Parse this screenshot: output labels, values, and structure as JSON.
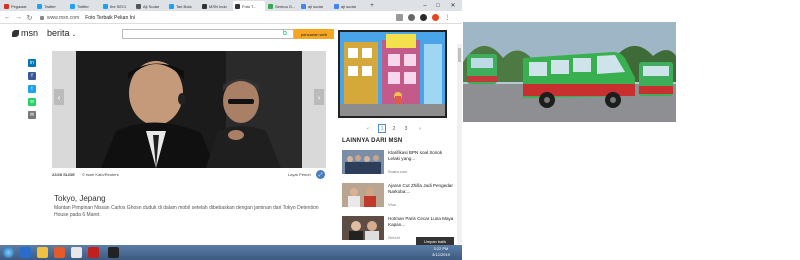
{
  "tabs": [
    {
      "label": "Pegawai",
      "color": "#d93025"
    },
    {
      "label": "Twitter",
      "color": "#1da1f2"
    },
    {
      "label": "Twitter",
      "color": "#1da1f2"
    },
    {
      "label": "the SECI",
      "color": "#1da1f2"
    },
    {
      "label": "Aji Sudar",
      "color": "#555555"
    },
    {
      "label": "Tari Bola",
      "color": "#1da1f2"
    },
    {
      "label": "MSN Indo",
      "color": "#333333"
    },
    {
      "label": "Foto T...",
      "color": "#333333",
      "active": true
    },
    {
      "label": "Semua G...",
      "color": "#34a853"
    },
    {
      "label": "aji sudar",
      "color": "#4285f4"
    },
    {
      "label": "aji sudar",
      "color": "#4285f4"
    }
  ],
  "address": {
    "host": "www.msn.com",
    "title": "Foto Terbaik Pekan Ini"
  },
  "header": {
    "logo": "msn",
    "section": "berita",
    "search_button": "pencarian web"
  },
  "slide": {
    "counter": "22/28 SLIDE",
    "credit": "© Issei Kato/Reuters",
    "fullscreen": "Layar Penuh",
    "title": "Tokyo, Jepang",
    "body": "Mantan Pimpinan Nissan Carlos Ghosn duduk di dalam mobil setelah dibebaskan dengan jaminan dari Tokyo Detention House pada 6 Maret."
  },
  "pager": {
    "pages": [
      "1",
      "2",
      "3"
    ]
  },
  "related": {
    "heading": "LAINNYA DARI MSN",
    "items": [
      {
        "title": "Klarifikasi BPN soal Sosok Lelaki yang...",
        "source": "Suara.com"
      },
      {
        "title": "Ajaran Cut Zhilla Jadi Pengedar Narkoba:...",
        "source": "Viva"
      },
      {
        "title": "Hotman Paris Cecar Luna Maya Kapan...",
        "source": "Grid.id"
      }
    ]
  },
  "feedback": "Umpan balik",
  "clock": {
    "time": "3:22 PM",
    "date": "3/12/2019"
  }
}
